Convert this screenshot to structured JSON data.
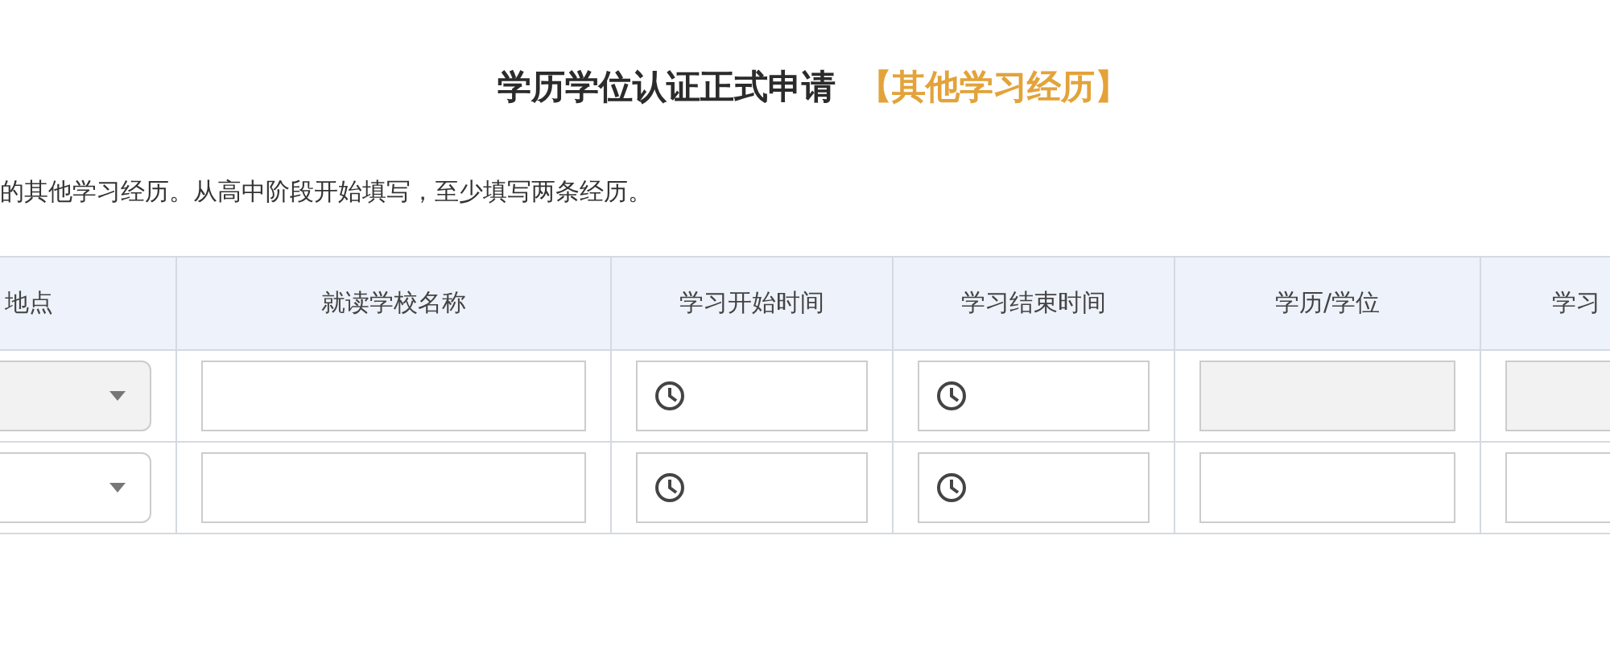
{
  "title": {
    "main": "学历学位认证正式申请",
    "section": "【其他学习经历】"
  },
  "instruction": "的其他学习经历。从高中阶段开始填写，至少填写两条经历。",
  "table": {
    "columns": [
      "地点",
      "就读学校名称",
      "学习开始时间",
      "学习结束时间",
      "学历/学位",
      "学习"
    ],
    "rows": [
      {
        "fields": [
          {
            "kind": "select",
            "disabled": true
          },
          {
            "kind": "text",
            "disabled": false
          },
          {
            "kind": "date",
            "disabled": false
          },
          {
            "kind": "date",
            "disabled": false
          },
          {
            "kind": "text",
            "disabled": true
          },
          {
            "kind": "text",
            "disabled": true
          }
        ]
      },
      {
        "fields": [
          {
            "kind": "select",
            "disabled": false
          },
          {
            "kind": "text",
            "disabled": false
          },
          {
            "kind": "date",
            "disabled": false
          },
          {
            "kind": "date",
            "disabled": false
          },
          {
            "kind": "text",
            "disabled": false
          },
          {
            "kind": "text",
            "disabled": false
          }
        ]
      }
    ]
  }
}
